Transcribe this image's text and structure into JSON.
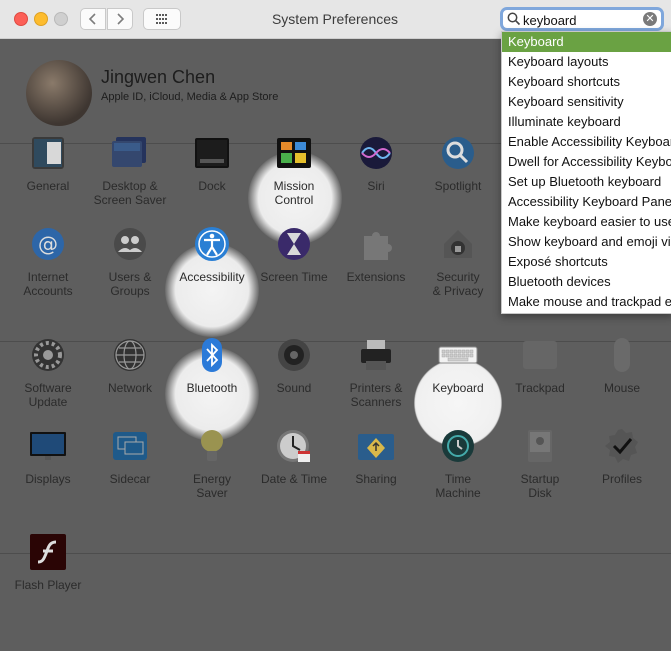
{
  "window": {
    "title": "System Preferences"
  },
  "search": {
    "value": "keyboard",
    "clear_icon": "clear-icon"
  },
  "user": {
    "name": "Jingwen Chen",
    "subtitle": "Apple ID, iCloud, Media & App Store"
  },
  "panes": [
    {
      "key": "general",
      "label": "General",
      "icon": "general-icon"
    },
    {
      "key": "desktop",
      "label": "Desktop &\nScreen Saver",
      "icon": "desktop-icon"
    },
    {
      "key": "dock",
      "label": "Dock",
      "icon": "dock-icon"
    },
    {
      "key": "mission",
      "label": "Mission\nControl",
      "icon": "mission-control-icon"
    },
    {
      "key": "siri",
      "label": "Siri",
      "icon": "siri-icon"
    },
    {
      "key": "spotlight",
      "label": "Spotlight",
      "icon": "spotlight-icon"
    },
    {
      "key": "internet",
      "label": "Internet\nAccounts",
      "icon": "at-icon"
    },
    {
      "key": "users",
      "label": "Users &\nGroups",
      "icon": "users-icon"
    },
    {
      "key": "accessibility",
      "label": "Accessibility",
      "icon": "accessibility-icon"
    },
    {
      "key": "screentime",
      "label": "Screen Time",
      "icon": "hourglass-icon"
    },
    {
      "key": "extensions",
      "label": "Extensions",
      "icon": "puzzle-icon"
    },
    {
      "key": "security",
      "label": "Security\n& Privacy",
      "icon": "house-lock-icon"
    },
    {
      "key": "software",
      "label": "Software\nUpdate",
      "icon": "gear-icon"
    },
    {
      "key": "network",
      "label": "Network",
      "icon": "globe-icon"
    },
    {
      "key": "bluetooth",
      "label": "Bluetooth",
      "icon": "bluetooth-icon"
    },
    {
      "key": "sound",
      "label": "Sound",
      "icon": "speaker-icon"
    },
    {
      "key": "printers",
      "label": "Printers &\nScanners",
      "icon": "printer-icon"
    },
    {
      "key": "keyboard",
      "label": "Keyboard",
      "icon": "keyboard-icon"
    },
    {
      "key": "trackpad",
      "label": "Trackpad",
      "icon": "trackpad-icon"
    },
    {
      "key": "mouse",
      "label": "Mouse",
      "icon": "mouse-icon"
    },
    {
      "key": "displays",
      "label": "Displays",
      "icon": "display-icon"
    },
    {
      "key": "sidecar",
      "label": "Sidecar",
      "icon": "sidecar-icon"
    },
    {
      "key": "energy",
      "label": "Energy\nSaver",
      "icon": "bulb-icon"
    },
    {
      "key": "datetime",
      "label": "Date & Time",
      "icon": "clock-icon"
    },
    {
      "key": "sharing",
      "label": "Sharing",
      "icon": "sharing-icon"
    },
    {
      "key": "timemachine",
      "label": "Time\nMachine",
      "icon": "time-machine-icon"
    },
    {
      "key": "startup",
      "label": "Startup\nDisk",
      "icon": "disk-icon"
    },
    {
      "key": "profiles",
      "label": "Profiles",
      "icon": "checkmark-badge-icon"
    },
    {
      "key": "flash",
      "label": "Flash Player",
      "icon": "flash-icon"
    }
  ],
  "suggestions": [
    "Keyboard",
    "Keyboard layouts",
    "Keyboard shortcuts",
    "Keyboard sensitivity",
    "Illuminate keyboard",
    "Enable Accessibility Keyboard",
    "Dwell for Accessibility Keyboard",
    "Set up Bluetooth keyboard",
    "Accessibility Keyboard Panel",
    "Make keyboard easier to use",
    "Show keyboard and emoji viewer",
    "Exposé shortcuts",
    "Bluetooth devices",
    "Make mouse and trackpad easier"
  ],
  "colors": {
    "selection": "#6aa243",
    "search_ring": "#7fa7dc",
    "dim": "#5e5e5e"
  }
}
